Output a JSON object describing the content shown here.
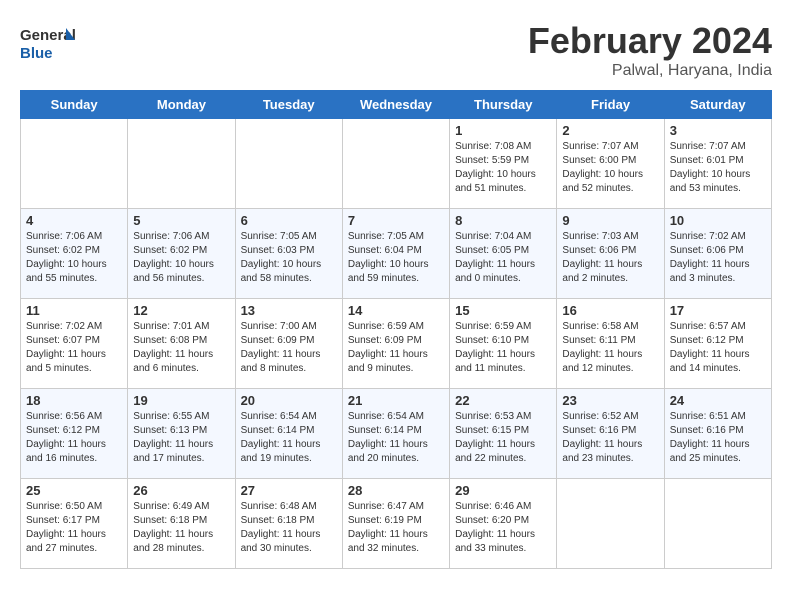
{
  "header": {
    "logo_text_general": "General",
    "logo_text_blue": "Blue",
    "title": "February 2024",
    "subtitle": "Palwal, Haryana, India"
  },
  "calendar": {
    "days_of_week": [
      "Sunday",
      "Monday",
      "Tuesday",
      "Wednesday",
      "Thursday",
      "Friday",
      "Saturday"
    ],
    "weeks": [
      [
        {
          "day": "",
          "info": ""
        },
        {
          "day": "",
          "info": ""
        },
        {
          "day": "",
          "info": ""
        },
        {
          "day": "",
          "info": ""
        },
        {
          "day": "1",
          "info": "Sunrise: 7:08 AM\nSunset: 5:59 PM\nDaylight: 10 hours\nand 51 minutes."
        },
        {
          "day": "2",
          "info": "Sunrise: 7:07 AM\nSunset: 6:00 PM\nDaylight: 10 hours\nand 52 minutes."
        },
        {
          "day": "3",
          "info": "Sunrise: 7:07 AM\nSunset: 6:01 PM\nDaylight: 10 hours\nand 53 minutes."
        }
      ],
      [
        {
          "day": "4",
          "info": "Sunrise: 7:06 AM\nSunset: 6:02 PM\nDaylight: 10 hours\nand 55 minutes."
        },
        {
          "day": "5",
          "info": "Sunrise: 7:06 AM\nSunset: 6:02 PM\nDaylight: 10 hours\nand 56 minutes."
        },
        {
          "day": "6",
          "info": "Sunrise: 7:05 AM\nSunset: 6:03 PM\nDaylight: 10 hours\nand 58 minutes."
        },
        {
          "day": "7",
          "info": "Sunrise: 7:05 AM\nSunset: 6:04 PM\nDaylight: 10 hours\nand 59 minutes."
        },
        {
          "day": "8",
          "info": "Sunrise: 7:04 AM\nSunset: 6:05 PM\nDaylight: 11 hours\nand 0 minutes."
        },
        {
          "day": "9",
          "info": "Sunrise: 7:03 AM\nSunset: 6:06 PM\nDaylight: 11 hours\nand 2 minutes."
        },
        {
          "day": "10",
          "info": "Sunrise: 7:02 AM\nSunset: 6:06 PM\nDaylight: 11 hours\nand 3 minutes."
        }
      ],
      [
        {
          "day": "11",
          "info": "Sunrise: 7:02 AM\nSunset: 6:07 PM\nDaylight: 11 hours\nand 5 minutes."
        },
        {
          "day": "12",
          "info": "Sunrise: 7:01 AM\nSunset: 6:08 PM\nDaylight: 11 hours\nand 6 minutes."
        },
        {
          "day": "13",
          "info": "Sunrise: 7:00 AM\nSunset: 6:09 PM\nDaylight: 11 hours\nand 8 minutes."
        },
        {
          "day": "14",
          "info": "Sunrise: 6:59 AM\nSunset: 6:09 PM\nDaylight: 11 hours\nand 9 minutes."
        },
        {
          "day": "15",
          "info": "Sunrise: 6:59 AM\nSunset: 6:10 PM\nDaylight: 11 hours\nand 11 minutes."
        },
        {
          "day": "16",
          "info": "Sunrise: 6:58 AM\nSunset: 6:11 PM\nDaylight: 11 hours\nand 12 minutes."
        },
        {
          "day": "17",
          "info": "Sunrise: 6:57 AM\nSunset: 6:12 PM\nDaylight: 11 hours\nand 14 minutes."
        }
      ],
      [
        {
          "day": "18",
          "info": "Sunrise: 6:56 AM\nSunset: 6:12 PM\nDaylight: 11 hours\nand 16 minutes."
        },
        {
          "day": "19",
          "info": "Sunrise: 6:55 AM\nSunset: 6:13 PM\nDaylight: 11 hours\nand 17 minutes."
        },
        {
          "day": "20",
          "info": "Sunrise: 6:54 AM\nSunset: 6:14 PM\nDaylight: 11 hours\nand 19 minutes."
        },
        {
          "day": "21",
          "info": "Sunrise: 6:54 AM\nSunset: 6:14 PM\nDaylight: 11 hours\nand 20 minutes."
        },
        {
          "day": "22",
          "info": "Sunrise: 6:53 AM\nSunset: 6:15 PM\nDaylight: 11 hours\nand 22 minutes."
        },
        {
          "day": "23",
          "info": "Sunrise: 6:52 AM\nSunset: 6:16 PM\nDaylight: 11 hours\nand 23 minutes."
        },
        {
          "day": "24",
          "info": "Sunrise: 6:51 AM\nSunset: 6:16 PM\nDaylight: 11 hours\nand 25 minutes."
        }
      ],
      [
        {
          "day": "25",
          "info": "Sunrise: 6:50 AM\nSunset: 6:17 PM\nDaylight: 11 hours\nand 27 minutes."
        },
        {
          "day": "26",
          "info": "Sunrise: 6:49 AM\nSunset: 6:18 PM\nDaylight: 11 hours\nand 28 minutes."
        },
        {
          "day": "27",
          "info": "Sunrise: 6:48 AM\nSunset: 6:18 PM\nDaylight: 11 hours\nand 30 minutes."
        },
        {
          "day": "28",
          "info": "Sunrise: 6:47 AM\nSunset: 6:19 PM\nDaylight: 11 hours\nand 32 minutes."
        },
        {
          "day": "29",
          "info": "Sunrise: 6:46 AM\nSunset: 6:20 PM\nDaylight: 11 hours\nand 33 minutes."
        },
        {
          "day": "",
          "info": ""
        },
        {
          "day": "",
          "info": ""
        }
      ]
    ]
  }
}
